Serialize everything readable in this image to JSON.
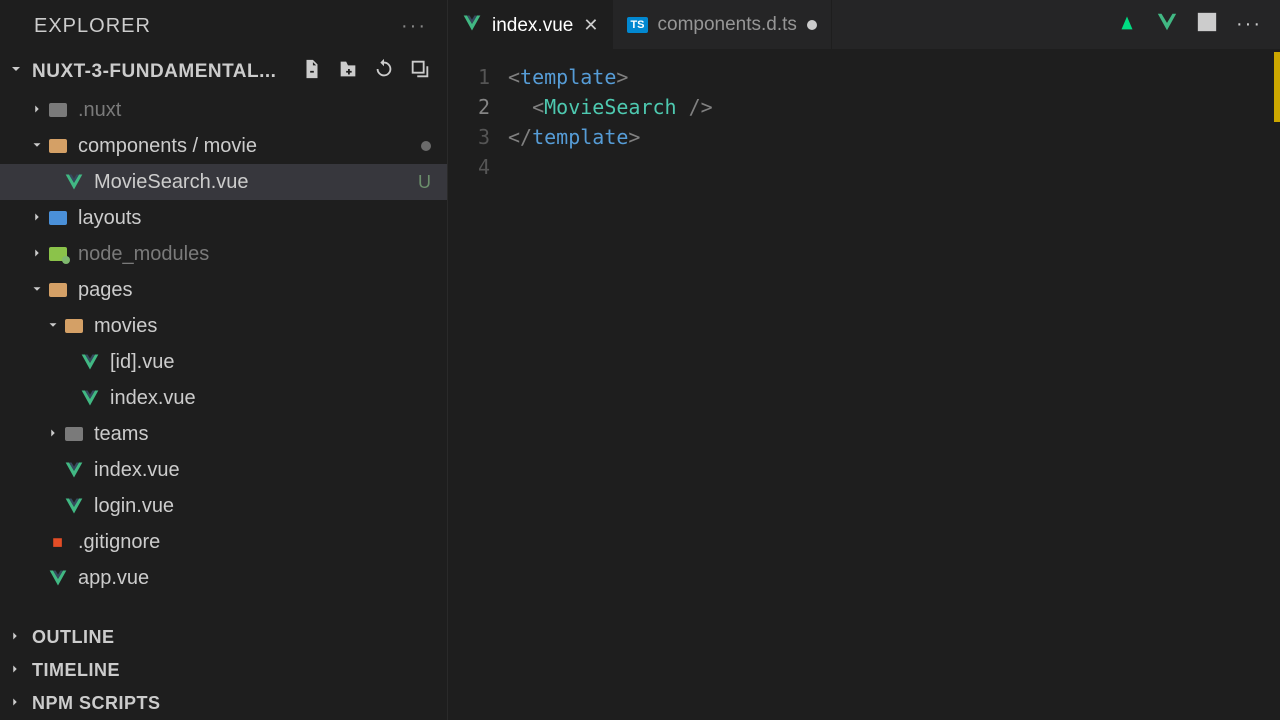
{
  "explorer": {
    "title": "EXPLORER"
  },
  "project": {
    "name": "NUXT-3-FUNDAMENTAL..."
  },
  "tree": {
    "nuxt": ".nuxt",
    "components": "components / movie",
    "moviesearch": {
      "name": "MovieSearch.vue",
      "status": "U"
    },
    "layouts": "layouts",
    "node_modules": "node_modules",
    "pages": "pages",
    "movies": "movies",
    "id_vue": "[id].vue",
    "index_vue": "index.vue",
    "teams": "teams",
    "pages_index": "index.vue",
    "login": "login.vue",
    "gitignore": ".gitignore",
    "app": "app.vue"
  },
  "sections": {
    "outline": "OUTLINE",
    "timeline": "TIMELINE",
    "npm": "NPM SCRIPTS"
  },
  "tabs": {
    "active": "index.vue",
    "second": "components.d.ts"
  },
  "code": {
    "line1": {
      "open": "<",
      "tag": "template",
      "close": ">"
    },
    "line2": {
      "open": "<",
      "comp": "MovieSearch",
      "selfclose": " />"
    },
    "line3": {
      "open": "</",
      "tag": "template",
      "close": ">"
    }
  },
  "lines": {
    "l1": "1",
    "l2": "2",
    "l3": "3",
    "l4": "4"
  }
}
